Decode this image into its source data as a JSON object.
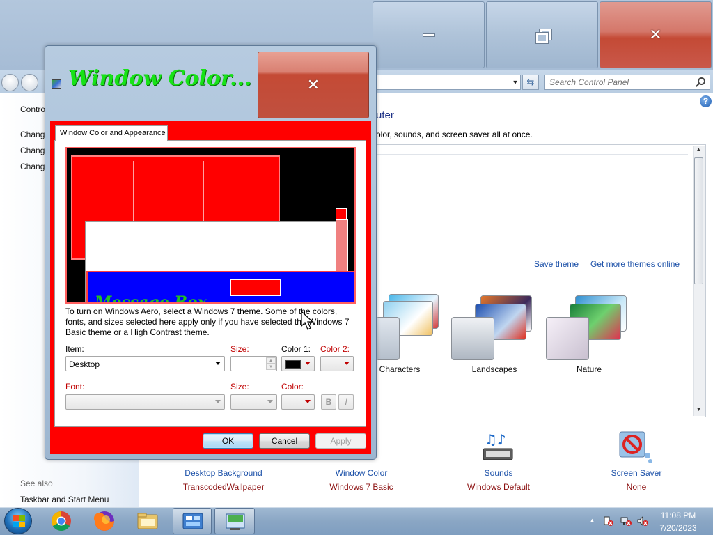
{
  "control_panel": {
    "search_placeholder": "Search Control Panel",
    "heading": "uter",
    "subtext": "olor, sounds, and screen saver all at once.",
    "left_links": [
      "Contro",
      "Chang",
      "Chang",
      "Chang"
    ],
    "see_also": "See also",
    "taskbar_link": "Taskbar and Start Menu",
    "save_theme": "Save theme",
    "get_more_themes": "Get more themes online",
    "themes": [
      "Characters",
      "Landscapes",
      "Nature"
    ],
    "tiles": [
      {
        "title": "Desktop Background",
        "sub": "TranscodedWallpaper"
      },
      {
        "title": "Window Color",
        "sub": "Windows 7 Basic"
      },
      {
        "title": "Sounds",
        "sub": "Windows Default"
      },
      {
        "title": "Screen Saver",
        "sub": "None"
      }
    ]
  },
  "dialog": {
    "title": "Window Color...",
    "tab": "Window Color and Appearance",
    "preview_message_box": "Message Box",
    "info": "To turn on Windows Aero, select a Windows 7 theme.  Some of the colors, fonts, and sizes selected here apply only if you have selected the Windows 7 Basic theme or a High Contrast theme.",
    "item_label": "Item:",
    "item_value": "Desktop",
    "size_label": "Size:",
    "color1_label": "Color 1:",
    "color2_label": "Color 2:",
    "font_label": "Font:",
    "font_size_label": "Size:",
    "font_color_label": "Color:",
    "bold_label": "B",
    "italic_label": "I",
    "ok": "OK",
    "cancel": "Cancel",
    "apply": "Apply",
    "color1_swatch": "#000000"
  },
  "taskbar": {
    "time": "11:08 PM",
    "date": "7/20/2023"
  },
  "colors": {
    "dialog_background": "#ff0000",
    "title_text": "#17e317",
    "link": "#1b50a8",
    "tile_subtitle": "#8b0f0f"
  }
}
